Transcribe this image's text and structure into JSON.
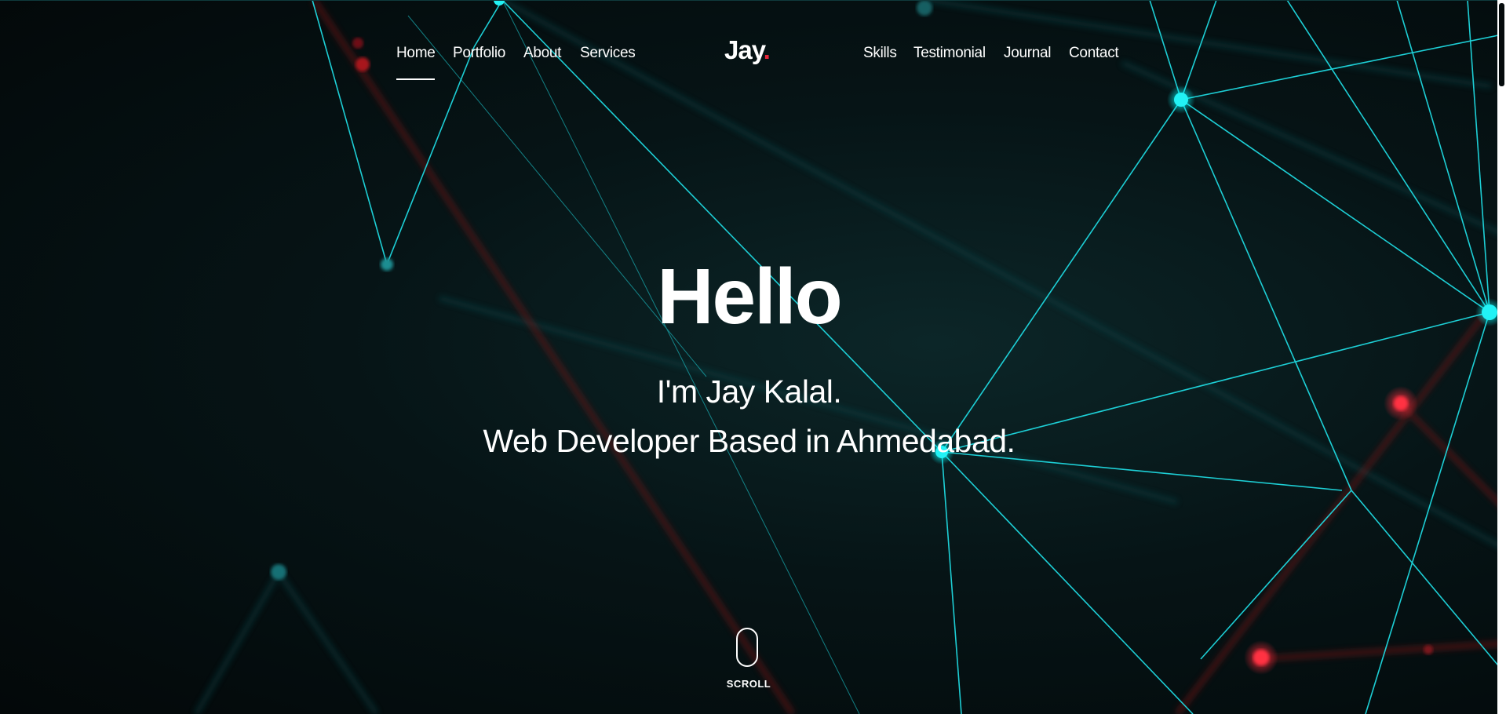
{
  "nav": {
    "left": [
      {
        "label": "Home",
        "active": true
      },
      {
        "label": "Portfolio"
      },
      {
        "label": "About"
      },
      {
        "label": "Services"
      }
    ],
    "right": [
      {
        "label": "Skills"
      },
      {
        "label": "Testimonial"
      },
      {
        "label": "Journal"
      },
      {
        "label": "Contact"
      }
    ]
  },
  "logo": {
    "text": "Jay",
    "dot": "."
  },
  "hero": {
    "title": "Hello",
    "line1": "I'm Jay Kalal.",
    "line2": "Web Developer Based in Ahmedabad."
  },
  "scroll": {
    "label": "SCROLL"
  },
  "colors": {
    "accent": "#e8263a",
    "network_line": "#1fd9e0",
    "background": "#040a0b"
  }
}
